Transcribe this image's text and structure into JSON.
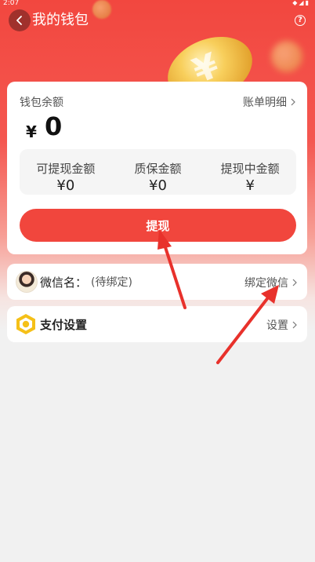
{
  "status_bar": {
    "time": "2:07"
  },
  "header": {
    "title": "我的钱包",
    "back_icon": "chevron-left-icon",
    "help_icon": "question-circle-icon"
  },
  "wallet": {
    "balance_label": "钱包余额",
    "statement_link": "账单明细",
    "currency": "¥",
    "balance": "0",
    "stats": [
      {
        "label": "可提现金额",
        "value": "¥0"
      },
      {
        "label": "质保金额",
        "value": "¥0"
      },
      {
        "label": "提现中金额",
        "value": "¥"
      }
    ],
    "withdraw_button": "提现"
  },
  "wechat_row": {
    "label": "微信名：",
    "value": "(待绑定)",
    "action": "绑定微信"
  },
  "payment_row": {
    "label": "支付设置",
    "action": "设置"
  },
  "colors": {
    "primary": "#f1463d",
    "background": "#f1f1f1",
    "annotation": "#e8312b"
  }
}
